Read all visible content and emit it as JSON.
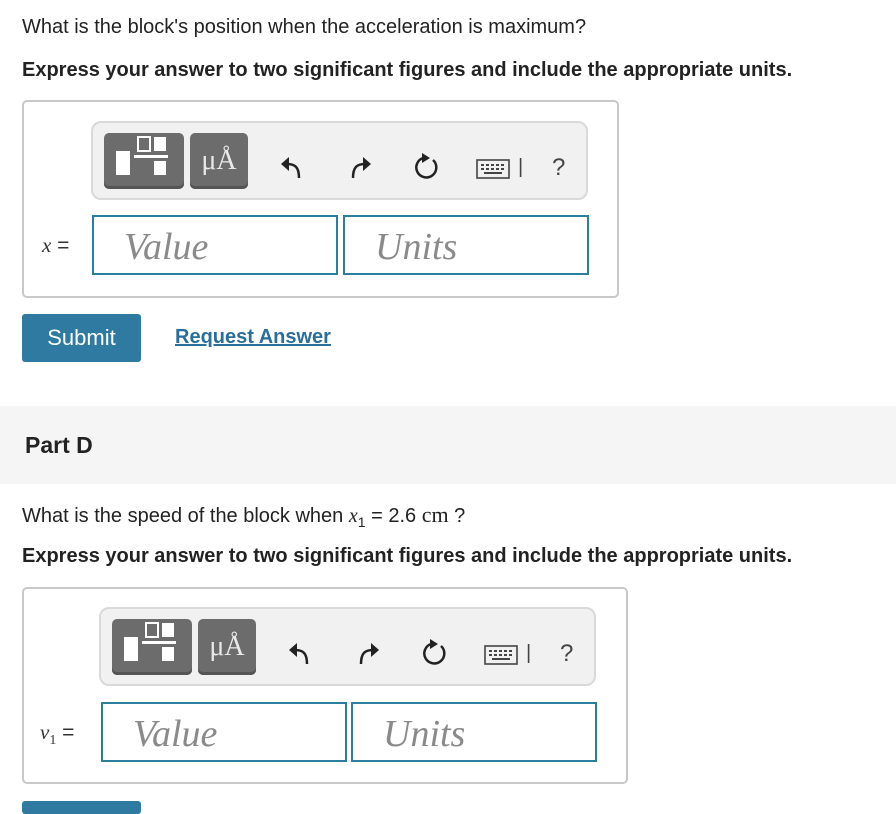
{
  "partC": {
    "question": "What is the block's position when the acceleration is maximum?",
    "instruction": "Express your answer to two significant figures and include the appropriate units.",
    "variable": "x",
    "equals": " =",
    "value_placeholder": "Value",
    "units_placeholder": "Units",
    "submit_label": "Submit",
    "request_label": "Request Answer"
  },
  "partD": {
    "title": "Part D",
    "question_pre": "What is the speed of the block when ",
    "question_var": "x",
    "question_sub": "1",
    "question_eq": " = 2.6 ",
    "question_unit": "cm",
    "question_post": " ?",
    "instruction": "Express your answer to two significant figures and include the appropriate units.",
    "variable": "v",
    "variable_sub": "1",
    "equals": " =",
    "value_placeholder": "Value",
    "units_placeholder": "Units"
  },
  "toolbar": {
    "mu_label": "μÅ",
    "help_label": "?",
    "separator": "|"
  },
  "colors": {
    "accent": "#2e7aa0",
    "field_border": "#2a7fa0",
    "toolbar_button": "#6c6c6c"
  }
}
